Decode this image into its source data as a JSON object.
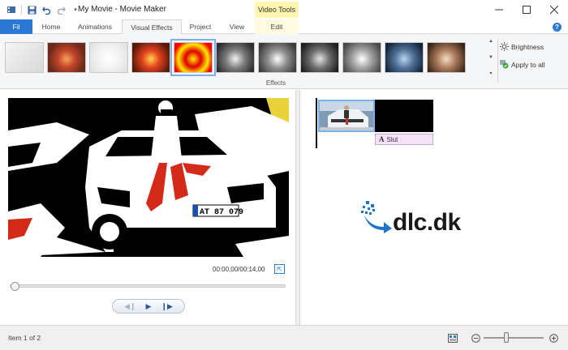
{
  "window": {
    "title": "My Movie - Movie Maker",
    "context_tab_group": "Video Tools"
  },
  "tabs": [
    {
      "label": "Fil"
    },
    {
      "label": "Home"
    },
    {
      "label": "Animations"
    },
    {
      "label": "Visual Effects"
    },
    {
      "label": "Project"
    },
    {
      "label": "View"
    },
    {
      "label": "Edit"
    }
  ],
  "active_tab": "Visual Effects",
  "ribbon": {
    "effects_group_label": "Effects",
    "brightness_label": "Brightness",
    "apply_all_label": "Apply to all",
    "effects": [
      {
        "name": "No effect",
        "style": "none"
      },
      {
        "name": "effect-2",
        "style": "warm"
      },
      {
        "name": "effect-3",
        "style": "sketch"
      },
      {
        "name": "effect-4",
        "style": "vivid"
      },
      {
        "name": "effect-5",
        "style": "threshold",
        "selected": true
      },
      {
        "name": "effect-6",
        "style": "bw"
      },
      {
        "name": "effect-7",
        "style": "bw2"
      },
      {
        "name": "effect-8",
        "style": "bw3"
      },
      {
        "name": "effect-9",
        "style": "bw4"
      },
      {
        "name": "effect-10",
        "style": "cyan"
      },
      {
        "name": "effect-11",
        "style": "sepia"
      }
    ]
  },
  "preview": {
    "timecode": "00:00,00/00:14,00",
    "license_plate": "AT 87 079"
  },
  "storyboard": {
    "caption_text": "Slut"
  },
  "watermark": {
    "text": "dlc.dk"
  },
  "statusbar": {
    "item_text": "Item 1 of 2",
    "zoom_level": 0.38
  },
  "colors": {
    "accent": "#2b78d6",
    "context_tab": "#fff6b0",
    "caption_bar": "#f4e3f7"
  }
}
